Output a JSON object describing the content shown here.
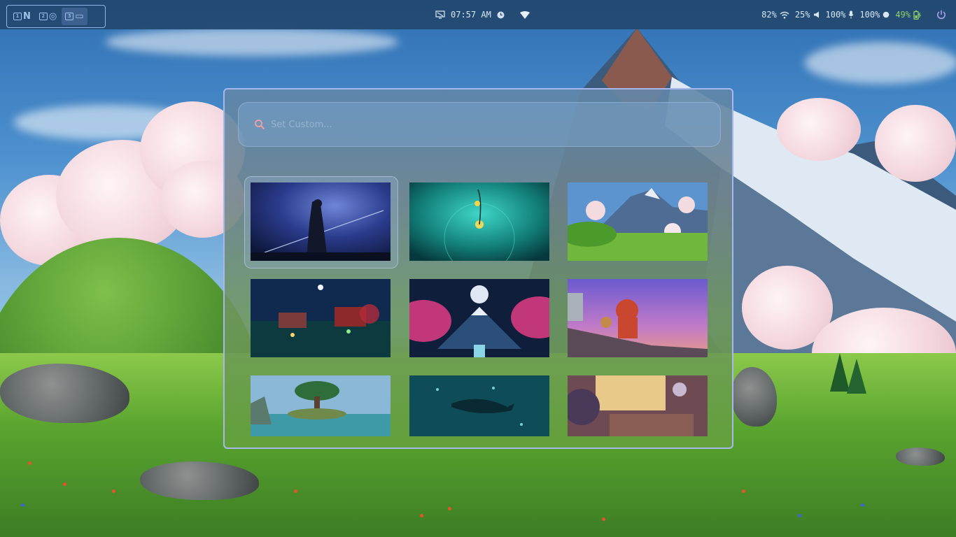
{
  "topbar": {
    "workspaces": [
      {
        "num": "1",
        "app": "N",
        "active": false
      },
      {
        "num": "2",
        "app": "◎",
        "active": false
      },
      {
        "num": "3",
        "app": "▭",
        "active": true
      }
    ],
    "center": {
      "time": "07:57 AM"
    },
    "status": {
      "network_percent": "82%",
      "volume_percent": "25%",
      "mic_percent": "100%",
      "brightness_percent": "100%",
      "battery_percent": "49%"
    },
    "colors": {
      "bar": "#22486e",
      "battery": "#8fd46a",
      "accent": "#8fb3e6"
    }
  },
  "picker": {
    "search": {
      "placeholder": "Set Custom...",
      "icon": "search-icon"
    },
    "thumbnails": [
      {
        "name": "starry-night-figure",
        "selected": true
      },
      {
        "name": "underwater-lantern",
        "selected": false
      },
      {
        "name": "mountain-meadow",
        "selected": false
      },
      {
        "name": "night-garden-temple",
        "selected": false
      },
      {
        "name": "moon-mountain-blossoms",
        "selected": false
      },
      {
        "name": "rooftop-sunset-character",
        "selected": false
      },
      {
        "name": "floating-tree-island",
        "selected": false
      },
      {
        "name": "underwater-whale",
        "selected": false
      },
      {
        "name": "cozy-room-window",
        "selected": false
      }
    ]
  }
}
